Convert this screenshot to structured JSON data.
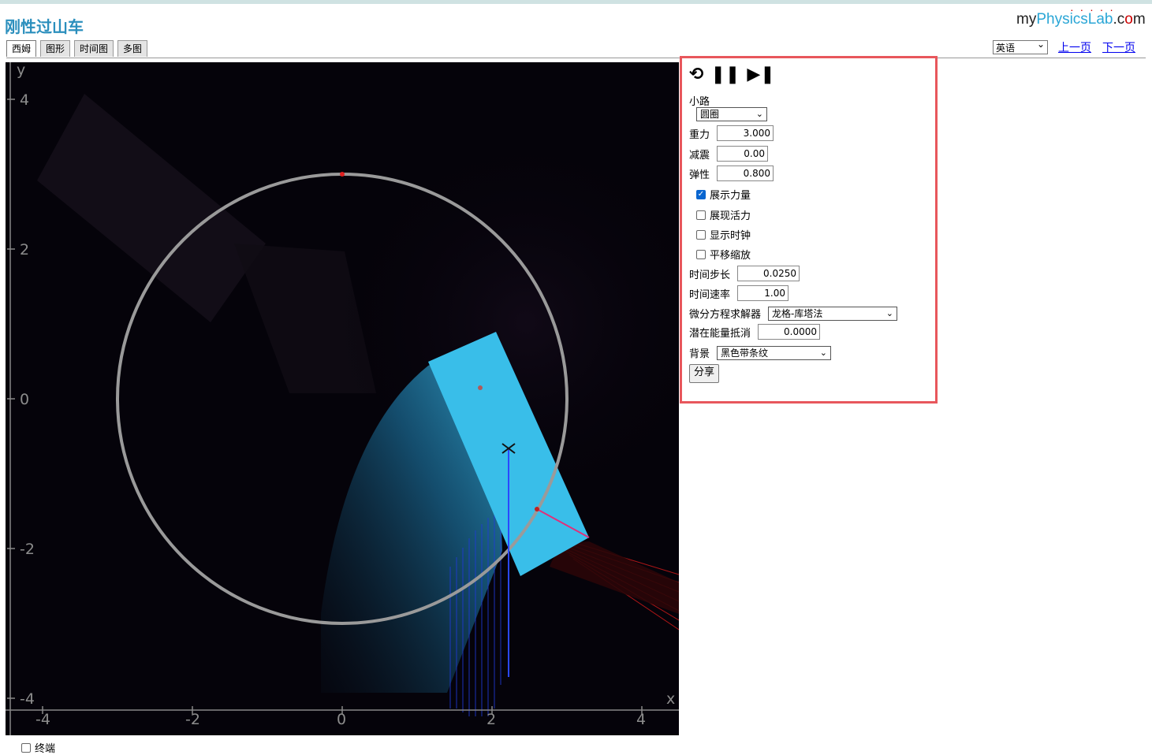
{
  "app": {
    "title": "刚性过山车",
    "logo": {
      "my": "my",
      "physics": "Physics",
      "lab": "Lab",
      "dot_c": ".c",
      "o": "o",
      "m": "m"
    }
  },
  "tabs": [
    {
      "label": "西姆",
      "active": true
    },
    {
      "label": "图形",
      "active": false
    },
    {
      "label": "时间图",
      "active": false
    },
    {
      "label": "多图",
      "active": false
    }
  ],
  "header": {
    "language": "英语",
    "prev_page": "上一页",
    "next_page": "下一页"
  },
  "graph": {
    "axis_x_label": "x",
    "axis_y_label": "y",
    "x_ticks": [
      "-4",
      "-2",
      "0",
      "2",
      "4"
    ],
    "y_ticks": [
      "4",
      "2",
      "0",
      "-2",
      "-4"
    ],
    "background": "#05030a",
    "track_color": "#9a9a9a",
    "block_color": "#3cc0ec"
  },
  "controls": {
    "icons": [
      "reset-icon",
      "pause-icon",
      "step-icon"
    ],
    "path_label": "小路",
    "path_value": "圆圈",
    "gravity_label": "重力",
    "gravity_value": "3.000",
    "damping_label": "减震",
    "damping_value": "0.00",
    "elasticity_label": "弹性",
    "elasticity_value": "0.800",
    "show_forces_label": "展示力量",
    "show_forces_checked": true,
    "show_energy_label": "展现活力",
    "show_energy_checked": false,
    "show_clock_label": "显示时钟",
    "show_clock_checked": false,
    "pan_zoom_label": "平移缩放",
    "pan_zoom_checked": false,
    "time_step_label": "时间步长",
    "time_step_value": "0.0250",
    "time_rate_label": "时间速率",
    "time_rate_value": "1.00",
    "solver_label": "微分方程求解器",
    "solver_value": "龙格-库塔法",
    "pe_offset_label": "潜在能量抵消",
    "pe_offset_value": "0.0000",
    "background_label": "背景",
    "background_value": "黑色带条纹",
    "share_label": "分享"
  },
  "footer": {
    "trails_label": "终端"
  }
}
